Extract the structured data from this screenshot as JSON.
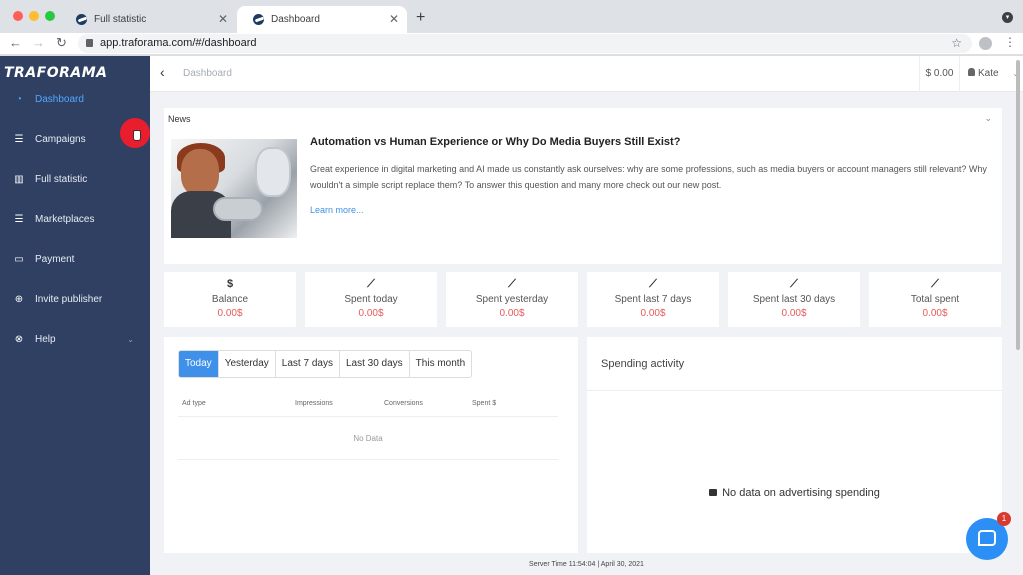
{
  "browser": {
    "tabs": [
      {
        "title": "Full statistic"
      },
      {
        "title": "Dashboard"
      }
    ],
    "url": "app.traforama.com/#/dashboard"
  },
  "sidebar": {
    "logo": "TRAFORAMA",
    "items": [
      {
        "label": "Dashboard",
        "icon": "dashboard-icon"
      },
      {
        "label": "Campaigns",
        "icon": "sliders-icon"
      },
      {
        "label": "Full statistic",
        "icon": "bar-chart-icon"
      },
      {
        "label": "Marketplaces",
        "icon": "sliders-icon"
      },
      {
        "label": "Payment",
        "icon": "credit-card-icon"
      },
      {
        "label": "Invite publisher",
        "icon": "plus-circle-icon"
      },
      {
        "label": "Help",
        "icon": "help-circle-icon"
      }
    ]
  },
  "topbar": {
    "breadcrumb": "Dashboard",
    "balance": "$ 0.00",
    "user": "Kate"
  },
  "news": {
    "heading": "News",
    "title": "Automation vs Human Experience or Why Do Media Buyers Still Exist?",
    "body": "Great experience in digital marketing and AI made us constantly ask ourselves: why are some professions, such as media buyers or account managers still relevant? Why wouldn't a simple script replace them? To answer this question and many more check out our new post.",
    "link": "Learn more..."
  },
  "stats": [
    {
      "icon": "$",
      "label": "Balance",
      "value": "0.00$"
    },
    {
      "icon": "⟋",
      "label": "Spent today",
      "value": "0.00$"
    },
    {
      "icon": "⟋",
      "label": "Spent yesterday",
      "value": "0.00$"
    },
    {
      "icon": "⟋",
      "label": "Spent last 7 days",
      "value": "0.00$"
    },
    {
      "icon": "⟋",
      "label": "Spent last 30 days",
      "value": "0.00$"
    },
    {
      "icon": "⟋",
      "label": "Total spent",
      "value": "0.00$"
    }
  ],
  "filters": [
    "Today",
    "Yesterday",
    "Last 7 days",
    "Last 30 days",
    "This month"
  ],
  "table": {
    "columns": [
      "Ad type",
      "Impressions",
      "Conversions",
      "Spent $"
    ],
    "empty": "No Data"
  },
  "spending": {
    "title": "Spending activity",
    "empty": "No data on advertising spending"
  },
  "footer": "Server Time 11:54:04 | April 30, 2021",
  "chat": {
    "badge": "1"
  },
  "colors": {
    "sidebar": "#2f4063",
    "accent": "#3f90e8",
    "value_red": "#e55b5b"
  }
}
